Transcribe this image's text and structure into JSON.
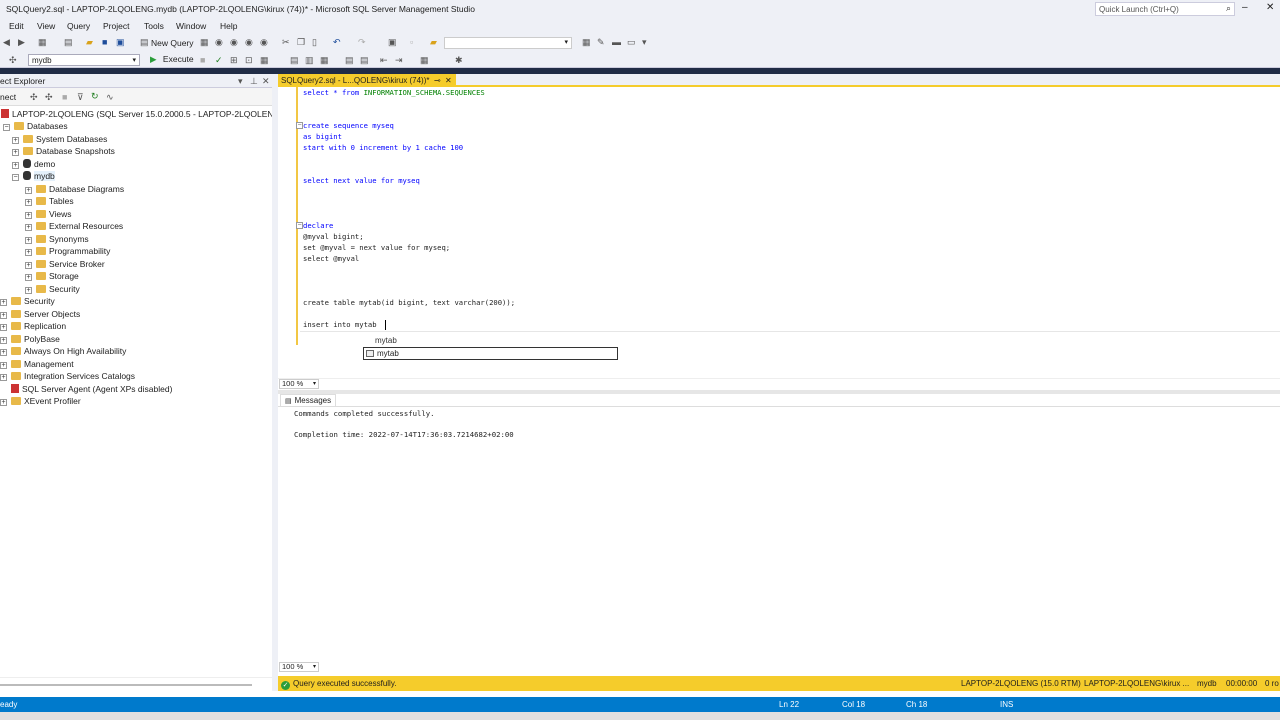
{
  "window": {
    "title": "SQLQuery2.sql - LAPTOP-2LQOLENG.mydb (LAPTOP-2LQOLENG\\kirux (74))* - Microsoft SQL Server Management Studio",
    "quick_launch": "Quick Launch (Ctrl+Q)"
  },
  "menu": [
    "Edit",
    "View",
    "Query",
    "Project",
    "Tools",
    "Window",
    "Help"
  ],
  "toolbar": {
    "new_query": "New Query",
    "database": "mydb",
    "execute": "Execute"
  },
  "object_explorer": {
    "title": "ect Explorer",
    "connect": "nect",
    "server": "LAPTOP-2LQOLENG (SQL Server 15.0.2000.5 - LAPTOP-2LQOLENG\\kiru",
    "items": [
      "Databases",
      "System Databases",
      "Database Snapshots",
      "demo",
      "mydb",
      "Database Diagrams",
      "Tables",
      "Views",
      "External Resources",
      "Synonyms",
      "Programmability",
      "Service Broker",
      "Storage",
      "Security",
      "Security",
      "Server Objects",
      "Replication",
      "PolyBase",
      "Always On High Availability",
      "Management",
      "Integration Services Catalogs",
      "SQL Server Agent (Agent XPs disabled)",
      "XEvent Profiler"
    ]
  },
  "tab": {
    "label": "SQLQuery2.sql - L...QOLENG\\kirux (74))*"
  },
  "editor": {
    "l1a": "select * from ",
    "l1b": "INFORMATION_SCHEMA.SEQUENCES",
    "l2": "create sequence myseq",
    "l3": "as bigint",
    "l4": "start with 0 increment by 1 cache 100",
    "l5": "select next value for myseq",
    "l6": "declare",
    "l7": "@myval bigint;",
    "l8": "set @myval = next value for myseq;",
    "l9": "select @myval",
    "l10": "create table mytab(id bigint, text varchar(200));",
    "l11": "insert into mytab",
    "autocomplete_hint": "mytab",
    "autocomplete_item": "mytab"
  },
  "zoom": "100 %",
  "messages": {
    "tab": "Messages",
    "line1": "Commands completed successfully.",
    "line2": "Completion time: 2022-07-14T17:36:03.7214682+02:00"
  },
  "query_status": {
    "text": "Query executed successfully.",
    "server": "LAPTOP-2LQOLENG (15.0 RTM)",
    "user": "LAPTOP-2LQOLENG\\kirux ...",
    "db": "mydb",
    "time": "00:00:00",
    "rows": "0 ro"
  },
  "statusbar": {
    "ready": "eady",
    "ln": "Ln 22",
    "col": "Col 18",
    "ch": "Ch 18",
    "mode": "INS"
  }
}
